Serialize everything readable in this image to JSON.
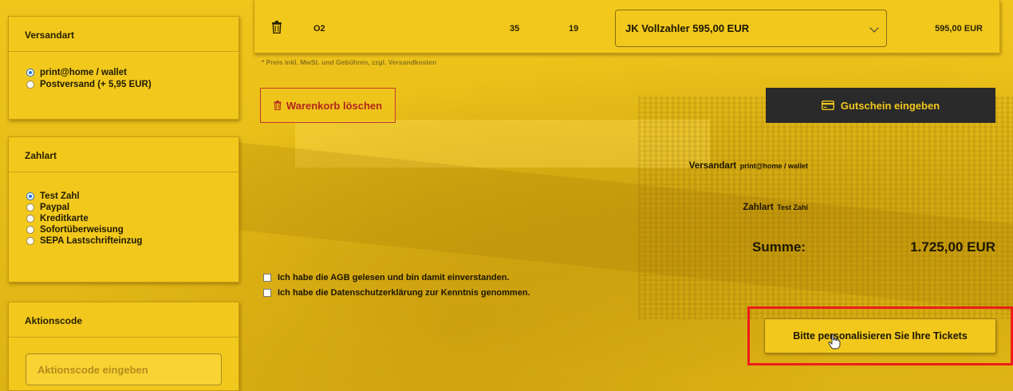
{
  "sidebar": {
    "shipping": {
      "title": "Versandart",
      "options": [
        {
          "label": "print@home / wallet",
          "selected": true
        },
        {
          "label": "Postversand (+ 5,95 EUR)",
          "selected": false
        }
      ]
    },
    "payment": {
      "title": "Zahlart",
      "options": [
        {
          "label": "Test Zahl",
          "selected": true
        },
        {
          "label": "Paypal",
          "selected": false
        },
        {
          "label": "Kreditkarte",
          "selected": false
        },
        {
          "label": "Sofortüberweisung",
          "selected": false
        },
        {
          "label": "SEPA Lastschrifteinzug",
          "selected": false
        }
      ]
    },
    "promo": {
      "title": "Aktionscode",
      "placeholder": "Aktionscode eingeben"
    }
  },
  "order": {
    "block": "O2",
    "row": "35",
    "seat": "19",
    "price_category": "JK Vollzahler 595,00 EUR",
    "price": "595,00 EUR",
    "note": "* Preis inkl. MwSt. und Gebühren, zzgl. Versandkosten"
  },
  "actions": {
    "clear_cart": "Warenkorb löschen",
    "voucher": "Gutschein eingeben",
    "personalize": "Bitte personalisieren Sie Ihre Tickets"
  },
  "summary": {
    "shipping_label": "Versandart",
    "shipping_value": "print@home / wallet",
    "payment_label": "Zahlart",
    "payment_value": "Test Zahl",
    "total_label": "Summe:",
    "total_value": "1.725,00 EUR"
  },
  "consents": {
    "agb": "Ich habe die AGB gelesen und bin damit einverstanden.",
    "privacy": "Ich habe die Datenschutzerklärung zur Kenntnis genommen."
  },
  "colors": {
    "background": "#e9bf1a",
    "accent_dark": "#2a2a2a",
    "danger": "#b3261e",
    "highlight": "#ee1c1c",
    "radio_selected": "#1a6fd6"
  }
}
